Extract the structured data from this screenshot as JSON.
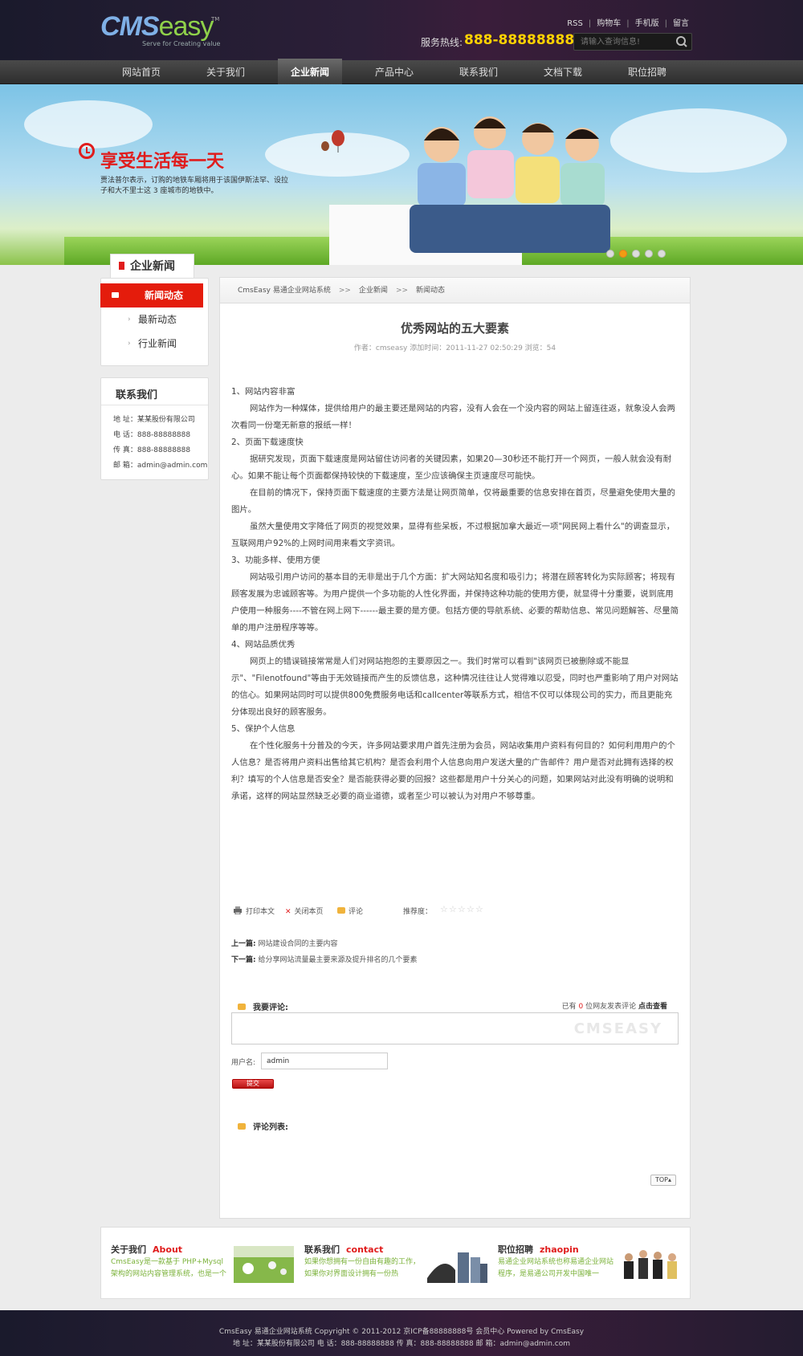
{
  "header": {
    "logo_text": "CMS",
    "logo_text2": "easy",
    "logo_tm": "TM",
    "logo_slogan": "Serve for Creating value",
    "top_links": [
      "RSS",
      "购物车",
      "手机版",
      "留言"
    ],
    "hotline_label": "服务热线:",
    "hotline_number": "888-88888888",
    "search_placeholder": "请输入查询信息!"
  },
  "nav": {
    "items": [
      {
        "label": "网站首页"
      },
      {
        "label": "关于我们"
      },
      {
        "label": "企业新闻",
        "active": true
      },
      {
        "label": "产品中心"
      },
      {
        "label": "联系我们"
      },
      {
        "label": "文档下载"
      },
      {
        "label": "职位招聘"
      }
    ]
  },
  "banner": {
    "title": "享受生活每一天",
    "description": "贾法普尔表示，订购的地铁车厢将用于该国伊斯法罕、设拉子和大不里士这 3 座城市的地铁中。",
    "dots": 5,
    "active_dot": 1
  },
  "sidebar": {
    "title": "企业新闻",
    "items": [
      {
        "label": "新闻动态",
        "active": true
      },
      {
        "label": "最新动态"
      },
      {
        "label": "行业新闻"
      }
    ],
    "contact": {
      "title": "联系我们",
      "rows": [
        "地 址：某某股份有限公司",
        "电 话：888-88888888",
        "传 真：888-88888888",
        "邮 箱：admin@admin.com"
      ]
    }
  },
  "article": {
    "breadcrumb": [
      "CmsEasy 易通企业网站系统",
      "企业新闻",
      "新闻动态"
    ],
    "breadcrumb_sep": ">>",
    "title": "优秀网站的五大要素",
    "meta": "作者：cmseasy   添加时间：2011-11-27 02:50:29   浏览：54",
    "paragraphs": [
      {
        "t": "1、网站内容非富",
        "indent": false
      },
      {
        "t": "网站作为一种媒体，提供给用户的最主要还是网站的内容，没有人会在一个没内容的网站上留连往返，就象没人会两次看同一份毫无新意的报纸一样！",
        "indent": true
      },
      {
        "t": "2、页面下载速度快",
        "indent": false
      },
      {
        "t": "据研究发现，页面下载速度是网站留住访问者的关键因素，如果20—30秒还不能打开一个网页，一般人就会没有耐心。如果不能让每个页面都保持较快的下载速度，至少应该确保主页速度尽可能快。",
        "indent": true
      },
      {
        "t": "在目前的情况下，保持页面下载速度的主要方法是让网页简单，仅将最重要的信息安排在首页，尽量避免使用大量的图片。",
        "indent": true
      },
      {
        "t": "虽然大量使用文字降低了网页的视觉效果，显得有些呆板，不过根据加拿大最近一项\"网民网上看什么\"的调查显示，互联网用户92%的上网时间用来看文字资讯。",
        "indent": true
      },
      {
        "t": "3、功能多样、使用方便",
        "indent": false
      },
      {
        "t": "网站吸引用户访问的基本目的无非是出于几个方面：扩大网站知名度和吸引力；将潜在顾客转化为实际顾客；将现有顾客发展为忠诚顾客等。为用户提供一个多功能的人性化界面，并保持这种功能的使用方便，就显得十分重要，说到底用户使用一种服务----不管在网上网下------最主要的是方便。包括方便的导航系统、必要的帮助信息、常见问题解答、尽量简单的用户注册程序等等。",
        "indent": true
      },
      {
        "t": "4、网站品质优秀",
        "indent": false
      },
      {
        "t": "网页上的错误链接常常是人们对网站抱怨的主要原因之一。我们时常可以看到\"该网页已被删除或不能显示\"、\"Filenotfound\"等由于无效链接而产生的反馈信息，这种情况往往让人觉得难以忍受，同时也严重影响了用户对网站的信心。如果网站同时可以提供800免费服务电话和callcenter等联系方式，相信不仅可以体现公司的实力，而且更能充分体现出良好的顾客服务。",
        "indent": true
      },
      {
        "t": "5、保护个人信息",
        "indent": false
      },
      {
        "t": "在个性化服务十分普及的今天，许多网站要求用户首先注册为会员，网站收集用户资料有何目的？如何利用用户的个人信息？是否将用户资料出售给其它机构？是否会利用个人信息向用户发送大量的广告邮件？用户是否对此拥有选择的权利？填写的个人信息是否安全？是否能获得必要的回报？这些都是用户十分关心的问题，如果网站对此没有明确的说明和承诺，这样的网站显然缺乏必要的商业道德，或者至少可以被认为对用户不够尊重。",
        "indent": true
      }
    ],
    "tools": {
      "print": "打印本文",
      "close": "关闭本页",
      "comment": "评论",
      "recommend": "推荐度：",
      "rating": 0,
      "stars": 5
    },
    "prev_label": "上一篇:",
    "prev_title": "网站建设合同的主要内容",
    "next_label": "下一篇:",
    "next_title": "给分享网站流量最主要来源及提升排名的几个要素"
  },
  "comments": {
    "heading": "我要评论:",
    "count_prefix": "已有",
    "count": "0",
    "count_suffix": "位网友发表评论",
    "view_all": "点击查看",
    "watermark": "CMSEASY",
    "username_label": "用户名:",
    "username_value": "admin",
    "submit_label": "提交",
    "list_heading": "评论列表:",
    "top_label": "TOP"
  },
  "footer_boxes": [
    {
      "title": "关于我们",
      "en": "About",
      "text": "CmsEasy是一款基于 PHP+Mysql 架构的网站内容管理系统，也是一个"
    },
    {
      "title": "联系我们",
      "en": "contact",
      "text": "如果你想拥有一份自由有趣的工作，如果你对界面设计拥有一份热"
    },
    {
      "title": "职位招聘",
      "en": "zhaopin",
      "text": "易通企业网站系统也称易通企业网站程序，是易通公司开发中国唯一"
    }
  ],
  "footer": {
    "line1": "CmsEasy 易通企业网站系统   Copyright © 2011-2012   京ICP备88888888号   会员中心   Powered by CmsEasy",
    "line2": "地 址：某某股份有限公司  电 话：888-88888888  传 真：888-88888888  邮 箱：admin@admin.com"
  },
  "colors": {
    "accent_red": "#e41c0c",
    "hotline_yellow": "#ffd200",
    "footer_green": "#7bb23a"
  }
}
